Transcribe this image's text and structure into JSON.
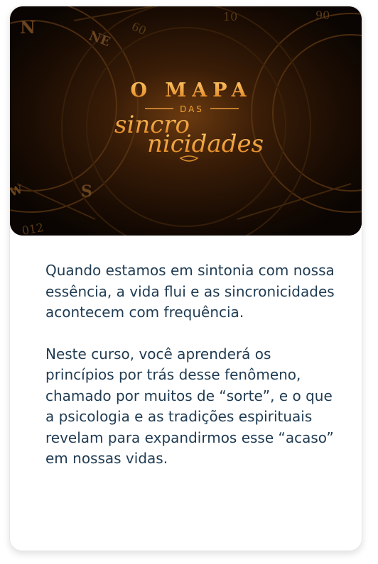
{
  "banner": {
    "title_line1": "O MAPA",
    "title_line2": "DAS",
    "title_script1": "sincro",
    "title_script2": "nicidades",
    "compass_letters": [
      "N",
      "NE",
      "S",
      "W"
    ],
    "dial_numbers": [
      "60",
      "10",
      "90",
      "012"
    ]
  },
  "description": {
    "paragraph1": "Quando estamos em sintonia com nossa essência, a vida flui e as sincronicidades acontecem com frequência.",
    "paragraph2": "Neste curso, você aprenderá os princípios por trás desse fenômeno, chamado por muitos de “sorte”, e o que a psicologia e as tradições espirituais revelam para expandirmos esse “acaso” em nossas vidas."
  },
  "colors": {
    "text": "#1f3b52",
    "title_gold": "#f0a030",
    "banner_bg": "#140a03"
  }
}
